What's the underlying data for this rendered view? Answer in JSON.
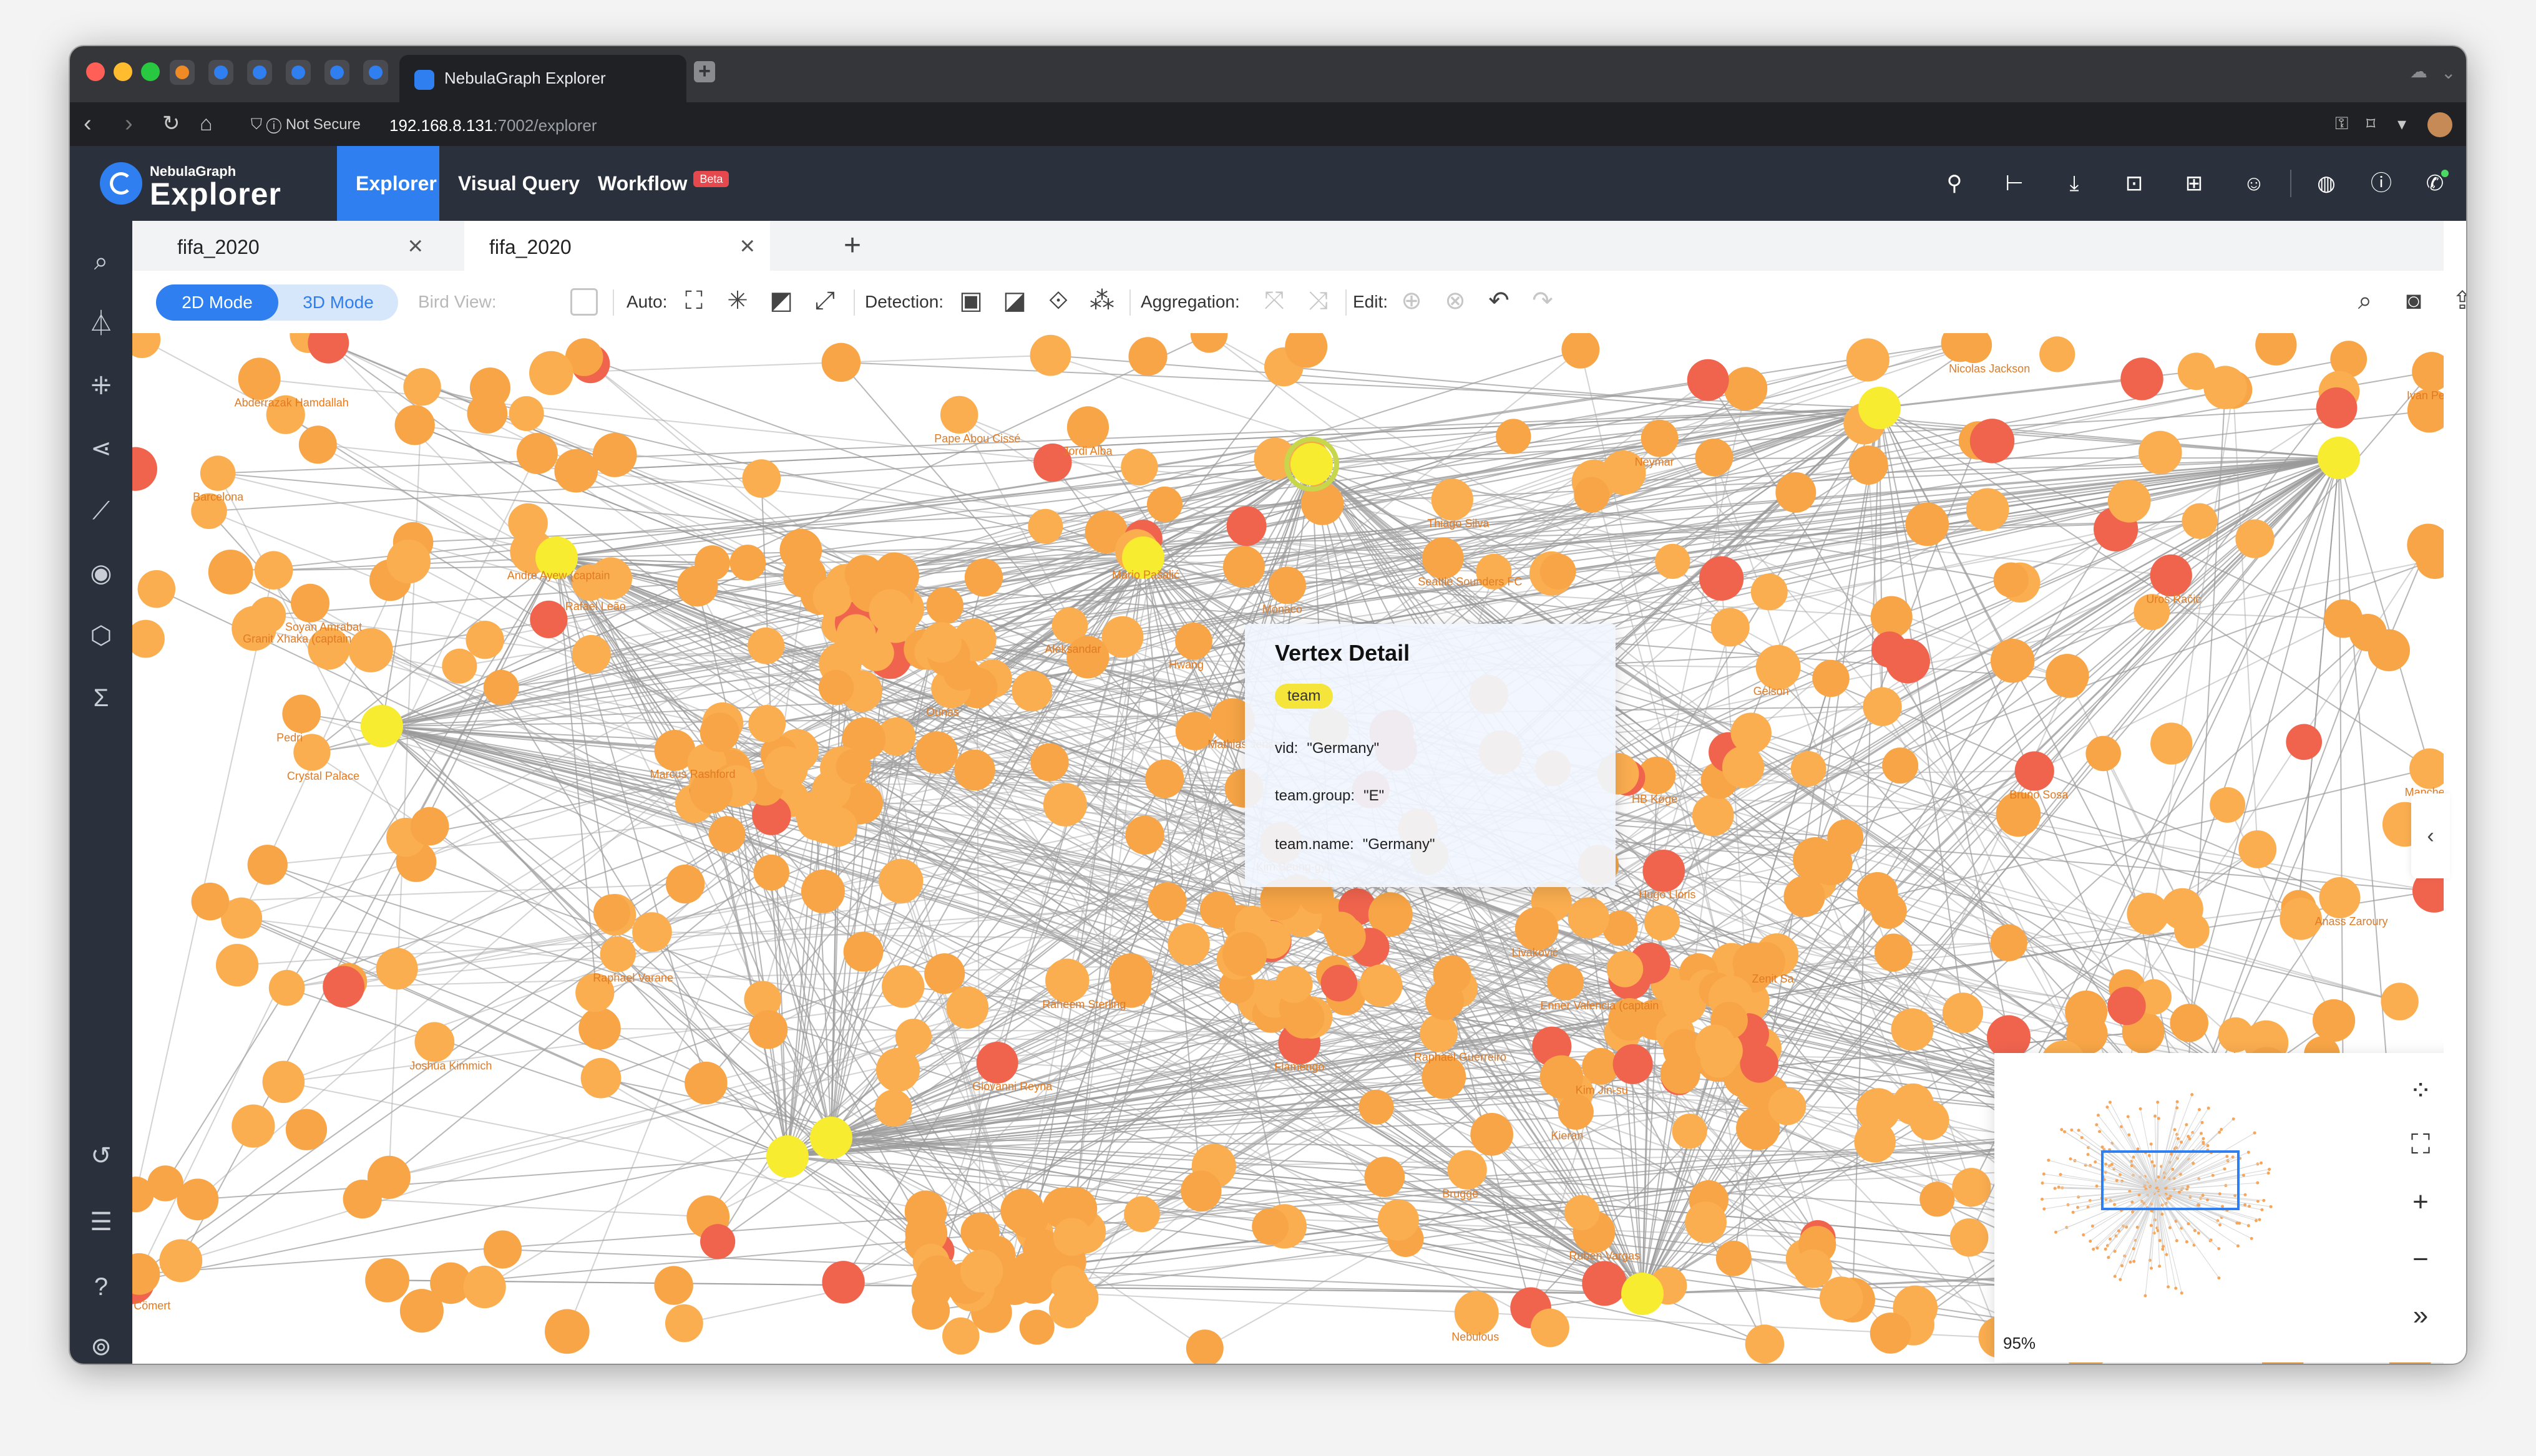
{
  "browser": {
    "tab_title": "NebulaGraph Explorer",
    "security_label": "Not Secure",
    "url_host": "192.168.8.131",
    "url_rest": ":7002/explorer"
  },
  "app": {
    "logo_top": "NebulaGraph",
    "logo_bottom": "Explorer",
    "nav": [
      "Explorer",
      "Visual Query",
      "Workflow"
    ],
    "beta_label": "Beta",
    "accent_color": "#2f7ff0",
    "header_color": "#2a313d"
  },
  "workspace_tabs": [
    "fifa_2020",
    "fifa_2020"
  ],
  "toolbar": {
    "mode_2d": "2D Mode",
    "mode_3d": "3D Mode",
    "bird_view_label": "Bird View:",
    "auto_label": "Auto:",
    "detection_label": "Detection:",
    "aggregation_label": "Aggregation:",
    "edit_label": "Edit:"
  },
  "vertex_detail": {
    "title": "Vertex Detail",
    "tag": "team",
    "rows": [
      {
        "key": "vid:",
        "value": "\"Germany\""
      },
      {
        "key": "team.group:",
        "value": "\"E\""
      },
      {
        "key": "team.name:",
        "value": "\"Germany\""
      }
    ]
  },
  "minimap": {
    "zoom": "95%"
  },
  "graph_labels": [
    "Eray Cömert",
    "Giovanni Reyna",
    "João Palhinha",
    "Granit Xhaka (captain",
    "Aleksandar",
    "Flamengo",
    "Crystal Palace",
    "Renato Steffen",
    "Uroš Račić",
    "Raphaël Guerreiro",
    "Joshua Kimmich",
    "Marcus Rashford",
    "Ruben Vargas",
    "Hugo Lloris",
    "HB Køge",
    "Barcelona",
    "Manchester",
    "Raphael Varane",
    "Jordi Alba",
    "Kim Seung-gyu",
    "Pape Abou Cissé",
    "Kim Jin-su",
    "Ángel Di María",
    "Andre Ayew (captain",
    "Anass Zaroury",
    "Enner Valencia (captain",
    "Bruno Sosa",
    "Soyan Amrabat",
    "Abderrazak Hamdallah",
    "Zenit Sa",
    "Ounas",
    "Nicolas Jackson",
    "Hwang",
    "Gelson",
    "Brugge",
    "Monaco",
    "Thiago Silva",
    "Mathias Jensen",
    "Livaković",
    "Ivan Perišić",
    "Nebulous",
    "Seattle Sounders FC",
    "Rafael Leão",
    "Pedri",
    "Raheem Sterling",
    "Kieran",
    "Carlos Gruezo",
    "Kai Havertz",
    "Neymar",
    "Mario Pašalić"
  ]
}
